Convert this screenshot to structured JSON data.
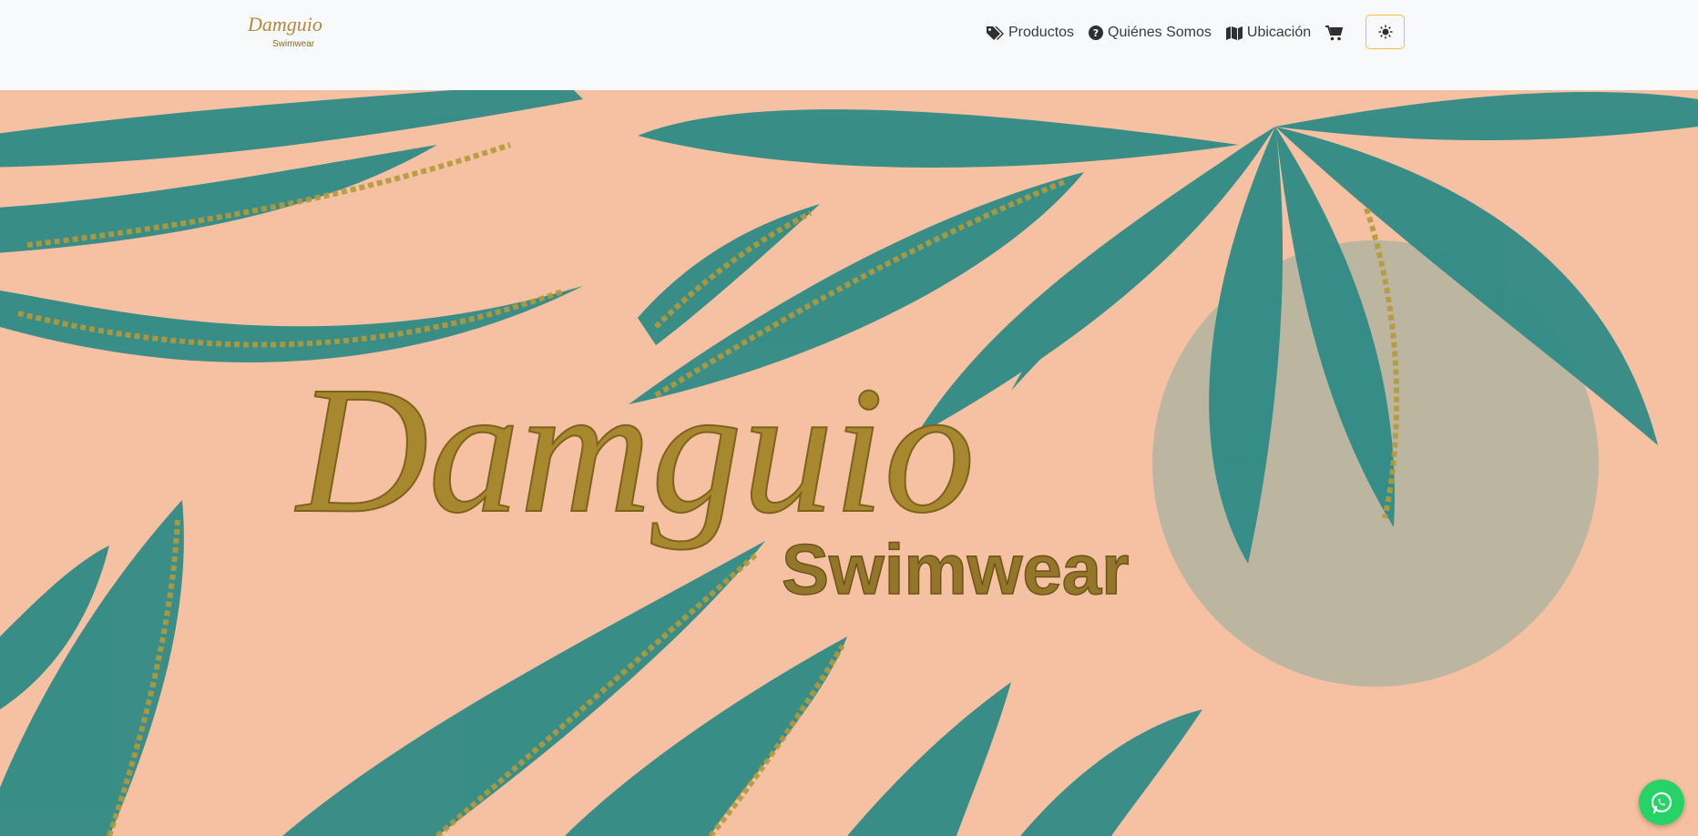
{
  "brand": {
    "name": "Damguio",
    "tagline": "Swimwear"
  },
  "nav": {
    "items": [
      {
        "label": "Productos",
        "icon": "tags-icon"
      },
      {
        "label": "Quiénes Somos",
        "icon": "question-circle-icon"
      },
      {
        "label": "Ubicación",
        "icon": "map-icon"
      }
    ],
    "cart_icon": "shopping-cart-icon",
    "theme_icon": "sun-icon"
  },
  "hero": {
    "title": "Damguio",
    "subtitle": "Swimwear"
  },
  "whatsapp": {
    "icon": "whatsapp-icon"
  },
  "colors": {
    "navbar_bg": "#f8f9fa",
    "hero_bg": "#f6c1a2",
    "leaf": "#2f8b86",
    "gold": "#a8882f",
    "sun": "#b8b4a0",
    "whatsapp": "#25d366",
    "theme_border": "#f0c040"
  }
}
